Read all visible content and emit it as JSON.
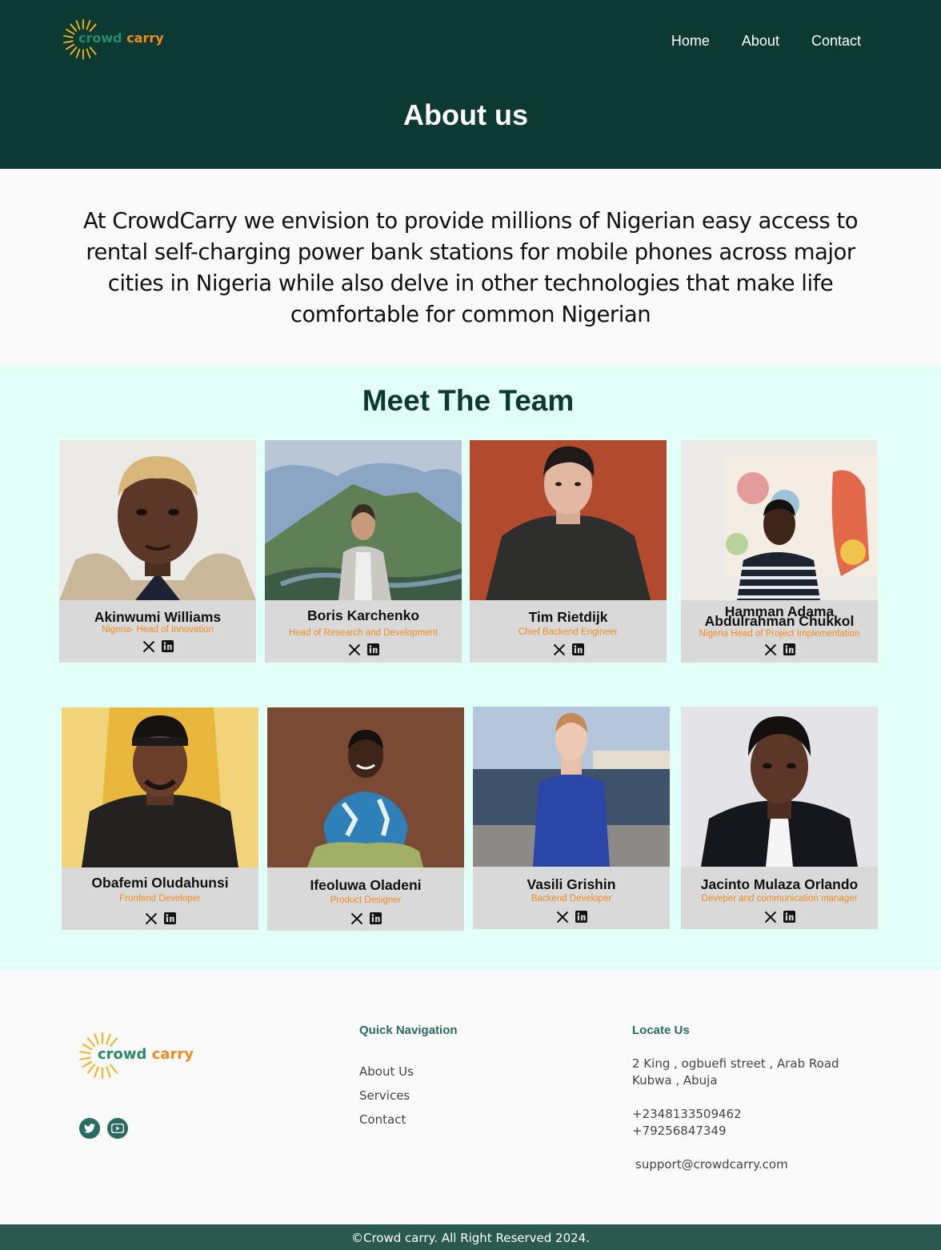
{
  "brand": {
    "word1": "crowd",
    "word2": "carry",
    "accent": "#f08c1c",
    "primary": "#0c3a33",
    "green": "#2a8a6a"
  },
  "nav": {
    "home": "Home",
    "about": "About",
    "contact": "Contact"
  },
  "hero": {
    "title": "About us"
  },
  "mission": {
    "text": "At CrowdCarry we envision to provide millions of Nigerian easy access to rental self-charging power bank stations for mobile phones across major cities in Nigeria while also delve in other technologies that make life comfortable for common Nigerian"
  },
  "team": {
    "title": "Meet The Team",
    "members": [
      {
        "name": "Akinwumi Williams",
        "role": "Nigeria- Head of Innovation"
      },
      {
        "name": "Boris Karchenko",
        "role": "Head of Research and Development"
      },
      {
        "name": "Tim Rietdijk",
        "role": "Chief Backend Engineer"
      },
      {
        "name": "Hamman Adama",
        "name2": "Abdulrahman Chukkol",
        "role": "Nigeria Head of Project Implementation"
      },
      {
        "name": "Obafemi Oludahunsi",
        "role": "Frontend Developer"
      },
      {
        "name": "Ifeoluwa Oladeni",
        "role": "Product Designer"
      },
      {
        "name": "Vasili Grishin",
        "role": "Backend Developer"
      },
      {
        "name": "Jacinto Mulaza  Orlando",
        "role": "Deveper and communication manager"
      }
    ]
  },
  "footer": {
    "quick_nav_title": "Quick Navigation",
    "links": [
      "About Us",
      "Services",
      "Contact"
    ],
    "locate_title": "Locate Us",
    "address_line1": "2 King , ogbuefi street , Arab Road",
    "address_line2": "Kubwa , Abuja",
    "phone1": "+2348133509462",
    "phone2": "+79256847349",
    "email": "support@crowdcarry.com",
    "copyright": "©Crowd carry. All Right Reserved 2024."
  }
}
